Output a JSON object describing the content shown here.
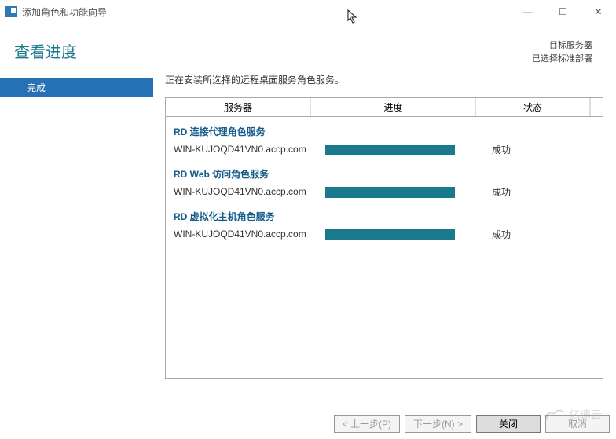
{
  "window": {
    "title": "添加角色和功能向导",
    "controls": {
      "min": "—",
      "max": "☐",
      "close": "✕"
    }
  },
  "header": {
    "page_title": "查看进度",
    "target_label": "目标服务器",
    "target_value": "已选择标准部署"
  },
  "sidebar": {
    "items": [
      {
        "label": "完成"
      }
    ]
  },
  "main": {
    "instruction": "正在安装所选择的远程桌面服务角色服务。",
    "columns": {
      "server": "服务器",
      "progress": "进度",
      "status": "状态"
    },
    "groups": [
      {
        "role": "RD 连接代理角色服务",
        "servers": [
          {
            "name": "WIN-KUJOQD41VN0.accp.com",
            "progress": 100,
            "status": "成功"
          }
        ]
      },
      {
        "role": "RD Web 访问角色服务",
        "servers": [
          {
            "name": "WIN-KUJOQD41VN0.accp.com",
            "progress": 100,
            "status": "成功"
          }
        ]
      },
      {
        "role": "RD 虚拟化主机角色服务",
        "servers": [
          {
            "name": "WIN-KUJOQD41VN0.accp.com",
            "progress": 100,
            "status": "成功"
          }
        ]
      }
    ]
  },
  "footer": {
    "prev": "< 上一步(P)",
    "next": "下一步(N) >",
    "close": "关闭",
    "cancel": "取消"
  },
  "watermark": "亿速云"
}
